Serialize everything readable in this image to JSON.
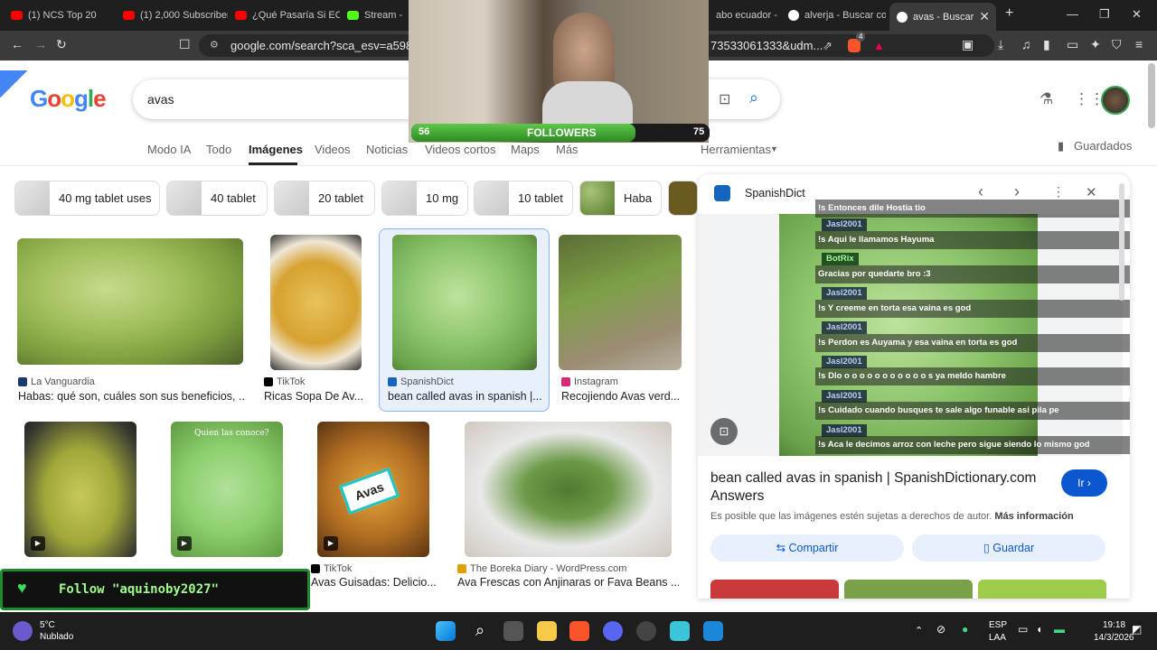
{
  "browser": {
    "tabs": [
      {
        "label": "(1) NCS Top 20",
        "color": "#ff0000"
      },
      {
        "label": "(1) 2,000 Subscribers",
        "color": "#ff0000"
      },
      {
        "label": "¿Qué Pasaría Si EC",
        "color": "#ff0000"
      },
      {
        "label": "Stream -",
        "color": "#53fc18"
      },
      {
        "label": "abo ecuador -",
        "color": "#888888"
      },
      {
        "label": "alverja - Buscar co",
        "color": "#4285f4"
      },
      {
        "label": "avas - Buscar",
        "color": "#4285f4"
      }
    ],
    "url": "google.com/search?sca_esv=a598d55f",
    "url_tail": "73533061333&udm...",
    "brave_badge": "4"
  },
  "search": {
    "logo": "Google",
    "query": "avas",
    "tabs": [
      "Modo IA",
      "Todo",
      "Imágenes",
      "Videos",
      "Noticias",
      "Videos cortos",
      "Maps",
      "Más"
    ],
    "active_tab": "Imágenes",
    "tools": "Herramientas",
    "saved": "Guardados"
  },
  "chips": [
    "40 mg tablet uses",
    "40 tablet",
    "20 tablet",
    "10 mg",
    "10 tablet",
    "Haba"
  ],
  "results": [
    {
      "source": "La Vanguardia",
      "title": "Habas: qué son, cuáles son sus beneficios, ...",
      "icon_color": "#1a3a6a"
    },
    {
      "source": "TikTok",
      "title": "Ricas Sopa De Av...",
      "icon_color": "#000000"
    },
    {
      "source": "SpanishDict",
      "title": "bean called avas in spanish |...",
      "icon_color": "#1565c0"
    },
    {
      "source": "Instagram",
      "title": "Recojiendo Avas verd...",
      "icon_color": "#d62976"
    },
    {
      "source": "TikTok",
      "title": "Avas Guisadas: Delicio...",
      "icon_color": "#000000"
    },
    {
      "source": "The Boreka Diary - WordPress.com",
      "title": "Ava Frescas con Anjinaras or Fava Beans ...",
      "icon_color": "#e0a000"
    }
  ],
  "overlay_texts": {
    "quien": "Quien las conoce?",
    "avas_label": "Avas"
  },
  "panel": {
    "site": "SpanishDict",
    "title": "bean called avas in spanish | SpanishDictionary.com Answers",
    "copyright": "Es posible que las imágenes estén sujetas a derechos de autor.",
    "more_info": "Más información",
    "visit": "Ir",
    "share": "Compartir",
    "save": "Guardar"
  },
  "chat": [
    {
      "user": "",
      "msg": "!s Entonces dile Hostia tio"
    },
    {
      "user": "Jasl2001",
      "msg": "!s Aqui le llamamos Hayuma"
    },
    {
      "user": "BotRix",
      "msg": "Gracias por quedarte bro :3"
    },
    {
      "user": "Jasl2001",
      "msg": "!s Y creeme en torta esa vaina es god"
    },
    {
      "user": "Jasl2001",
      "msg": "!s Perdon es Auyama y esa vaina en torta es god"
    },
    {
      "user": "Jasl2001",
      "msg": "!s Dlo o o o o o o o o o o o s ya meldo hambre"
    },
    {
      "user": "Jasl2001",
      "msg": "!s Cuidado cuando busques te sale algo funable asi pila pe"
    },
    {
      "user": "Jasl2001",
      "msg": "!s Aca le decimos arroz con leche pero sigue siendo lo mismo god"
    }
  ],
  "stream": {
    "followers_label": "FOLLOWERS",
    "followers_current": "56",
    "followers_goal": "75",
    "followers_progress": 0.75,
    "follow_cta": "Follow \"aquinoby2027\""
  },
  "taskbar": {
    "weather_temp": "5°C",
    "weather_desc": "Nublado",
    "lang": "ESP",
    "lang2": "LAA",
    "time": "19:18",
    "date": "14/3/2026"
  }
}
